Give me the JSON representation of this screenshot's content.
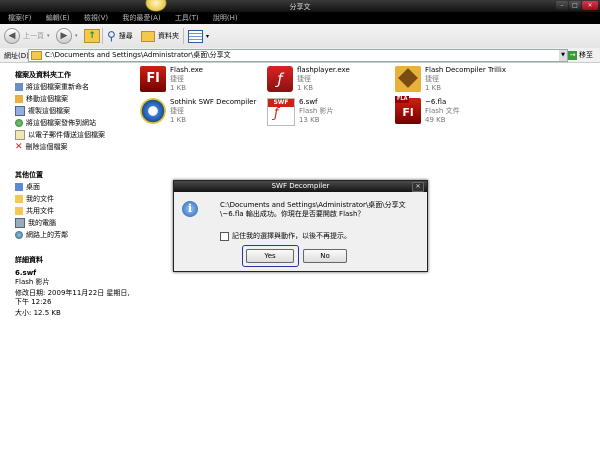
{
  "window": {
    "title": "分享文",
    "min": "–",
    "max": "□",
    "close": "✕"
  },
  "menu": [
    "檔案(F)",
    "編輯(E)",
    "檢視(V)",
    "我的最愛(A)",
    "工具(T)",
    "說明(H)"
  ],
  "toolbar": {
    "back": "上一頁",
    "search": "搜尋",
    "folders": "資料夾",
    "view": "▾"
  },
  "address": {
    "label": "網址(D)",
    "path": "C:\\Documents and Settings\\Administrator\\桌面\\分享文",
    "go": "移至"
  },
  "sidebar": {
    "file_tasks_title": "檔案及資料夾工作",
    "file_tasks": [
      "將這個檔案重新命名",
      "移動這個檔案",
      "複製這個檔案",
      "將這個檔案發佈到網站",
      "以電子郵件傳送這個檔案",
      "刪除這個檔案"
    ],
    "other_places_title": "其他位置",
    "other_places": [
      "桌面",
      "我的文件",
      "共用文件",
      "我的電腦",
      "網路上的芳鄰"
    ],
    "details_title": "詳細資料",
    "details": {
      "name": "6.swf",
      "type": "Flash 影片",
      "modified": "修改日期: 2009年11月22日 星期日, 下午 12:26",
      "size": "大小: 12.5 KB"
    }
  },
  "files": [
    {
      "name": "Flash.exe",
      "type": "捷徑",
      "size": "1 KB"
    },
    {
      "name": "flashplayer.exe",
      "type": "捷徑",
      "size": "1 KB"
    },
    {
      "name": "Flash Decompiler Trillix",
      "type": "捷徑",
      "size": "1 KB"
    },
    {
      "name": "Sothink SWF Decompiler",
      "type": "捷徑",
      "size": "1 KB"
    },
    {
      "name": "6.swf",
      "type": "Flash 影片",
      "size": "13 KB"
    },
    {
      "name": "~6.fla",
      "type": "Flash 文件",
      "size": "49 KB"
    }
  ],
  "dialog": {
    "title": "SWF Decompiler",
    "message": "C:\\Documents and Settings\\Administrator\\桌面\\分享文\\~6.fla 輸出成功。你現在是否要開啟 Flash？",
    "checkbox": "記住我的選擇與動作，以後不再提示。",
    "yes": "Yes",
    "no": "No"
  }
}
